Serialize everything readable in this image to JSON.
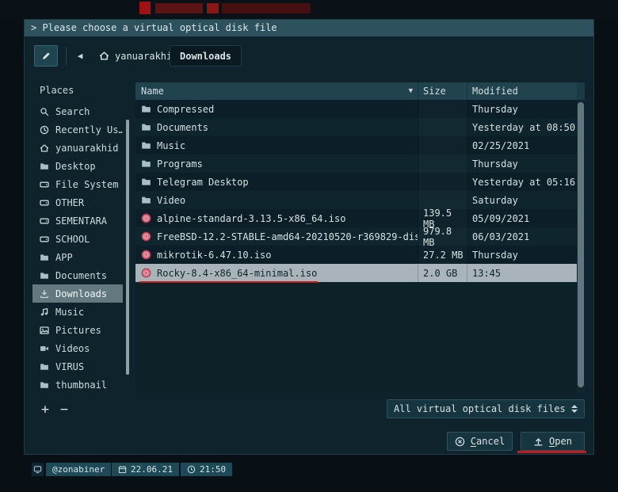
{
  "window": {
    "title": "> Please choose a virtual optical disk file"
  },
  "toolbar": {
    "back_icon": "◀",
    "home_crumb": "yanuarakhid",
    "current_crumb": "Downloads"
  },
  "sidebar": {
    "header": "Places",
    "items": [
      {
        "icon": "search",
        "label": "Search"
      },
      {
        "icon": "clock",
        "label": "Recently Us…"
      },
      {
        "icon": "home",
        "label": "yanuarakhid"
      },
      {
        "icon": "folder",
        "label": "Desktop"
      },
      {
        "icon": "drive",
        "label": "File System"
      },
      {
        "icon": "drive",
        "label": "OTHER"
      },
      {
        "icon": "drive",
        "label": "SEMENTARA"
      },
      {
        "icon": "drive",
        "label": "SCHOOL"
      },
      {
        "icon": "folder",
        "label": "APP"
      },
      {
        "icon": "folder",
        "label": "Documents"
      },
      {
        "icon": "download",
        "label": "Downloads",
        "selected": true
      },
      {
        "icon": "music",
        "label": "Music"
      },
      {
        "icon": "image",
        "label": "Pictures"
      },
      {
        "icon": "video",
        "label": "Videos"
      },
      {
        "icon": "folder",
        "label": "VIRUS"
      },
      {
        "icon": "folder",
        "label": "thumbnail"
      }
    ]
  },
  "file_list": {
    "columns": {
      "name": "Name",
      "size": "Size",
      "modified": "Modified"
    },
    "sort_indicator": "▼",
    "rows": [
      {
        "icon": "folder",
        "name": "Compressed",
        "size": "",
        "modified": "Thursday"
      },
      {
        "icon": "folder",
        "name": "Documents",
        "size": "",
        "modified": "Yesterday at 08:50"
      },
      {
        "icon": "folder",
        "name": "Music",
        "size": "",
        "modified": "02/25/2021"
      },
      {
        "icon": "folder",
        "name": "Programs",
        "size": "",
        "modified": "Thursday"
      },
      {
        "icon": "folder",
        "name": "Telegram Desktop",
        "size": "",
        "modified": "Yesterday at 05:16"
      },
      {
        "icon": "folder",
        "name": "Video",
        "size": "",
        "modified": "Saturday"
      },
      {
        "icon": "disc",
        "name": "alpine-standard-3.13.5-x86_64.iso",
        "size": "139.5 MB",
        "modified": "05/09/2021"
      },
      {
        "icon": "disc",
        "name": "FreeBSD-12.2-STABLE-amd64-20210520-r369829-dis…",
        "size": "979.8 MB",
        "modified": "06/03/2021"
      },
      {
        "icon": "disc",
        "name": "mikrotik-6.47.10.iso",
        "size": "27.2 MB",
        "modified": "Thursday"
      },
      {
        "icon": "disc",
        "name": "Rocky-8.4-x86_64-minimal.iso",
        "size": "2.0 GB",
        "modified": "13:45",
        "selected": true,
        "annotated": true
      }
    ]
  },
  "footer": {
    "add": "+",
    "remove": "−",
    "filter_value": "All virtual optical disk files",
    "cancel": {
      "mnemonic": "C",
      "rest": "ancel"
    },
    "open": {
      "mnemonic": "O",
      "rest": "pen"
    }
  },
  "statusbar": {
    "user": "@zonabiner",
    "date": "22.06.21",
    "time": "21:50"
  },
  "colors": {
    "annotation_red": "#c41a1a",
    "selection_gray": "#a8b4b9",
    "sidebar_selection": "#64787f",
    "titlebar": "#2d525d",
    "dialog_bg": "#0e232c"
  }
}
